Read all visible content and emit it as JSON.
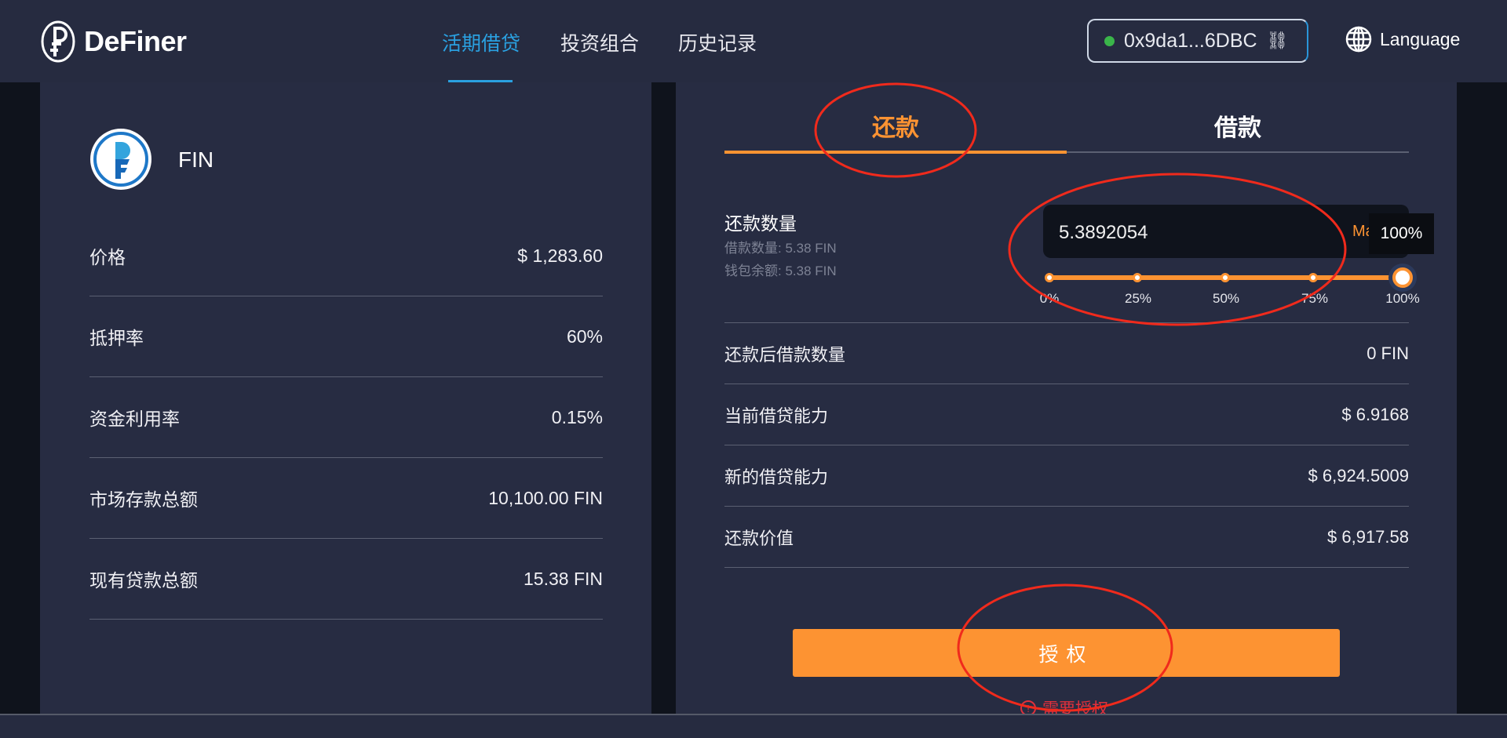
{
  "header": {
    "brand": "DeFiner",
    "nav": [
      {
        "label": "活期借贷",
        "active": true
      },
      {
        "label": "投资组合"
      },
      {
        "label": "历史记录"
      }
    ],
    "wallet": {
      "address": "0x9da1...6DBC",
      "status_color": "#3ab54a"
    },
    "language_label": "Language"
  },
  "left": {
    "token": "FIN",
    "rows": [
      {
        "label": "价格",
        "value": "$ 1,283.60"
      },
      {
        "label": "抵押率",
        "value": "60%"
      },
      {
        "label": "资金利用率",
        "value": "0.15%"
      },
      {
        "label": "市场存款总额",
        "value": "10,100.00 FIN"
      },
      {
        "label": "现有贷款总额",
        "value": "15.38 FIN"
      }
    ]
  },
  "right": {
    "tabs": [
      {
        "label": "还款",
        "active": true
      },
      {
        "label": "借款"
      }
    ],
    "amount": {
      "label": "还款数量",
      "borrowed": "借款数量: 5.38 FIN",
      "wallet": "钱包余额: 5.38 FIN",
      "value": "5.3892054",
      "max_label": "Max",
      "tooltip": "100%",
      "slider_percent": 100,
      "ticks": [
        "0%",
        "25%",
        "50%",
        "75%",
        "100%"
      ]
    },
    "rows": [
      {
        "label": "还款后借款数量",
        "value": "0 FIN"
      },
      {
        "label": "当前借贷能力",
        "value": "$ 6.9168"
      },
      {
        "label": "新的借贷能力",
        "value": "$ 6,924.5009"
      },
      {
        "label": "还款价值",
        "value": "$ 6,917.58"
      }
    ],
    "button": "授权",
    "notice": "需要授权"
  },
  "colors": {
    "accent": "#fd9332",
    "nav_active": "#2aa0e0",
    "panel": "#272c42",
    "warning": "#e0303c"
  }
}
